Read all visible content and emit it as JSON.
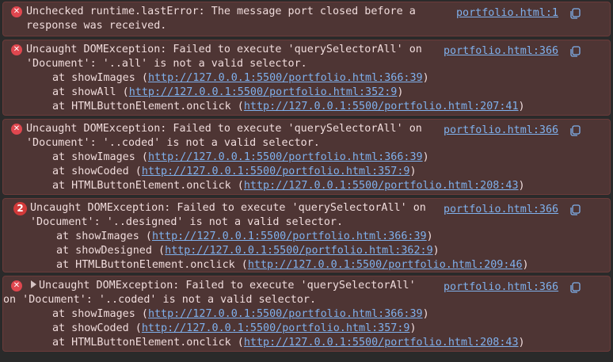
{
  "messages": [
    {
      "kind": "error",
      "lines": [
        "Unchecked runtime.lastError: The message port closed before a",
        "response was received."
      ],
      "source": "portfolio.html:1",
      "stack": []
    },
    {
      "kind": "error",
      "lines": [
        "Uncaught DOMException: Failed to execute 'querySelectorAll' on",
        "'Document': '..all' is not a valid selector."
      ],
      "source": "portfolio.html:366",
      "stack": [
        {
          "prefix": "at showImages (",
          "url": "http://127.0.0.1:5500/portfolio.html:366:39",
          "suffix": ")"
        },
        {
          "prefix": "at showAll (",
          "url": "http://127.0.0.1:5500/portfolio.html:352:9",
          "suffix": ")"
        },
        {
          "prefix": "at HTMLButtonElement.onclick (",
          "url": "http://127.0.0.1:5500/portfolio.html:207:41",
          "suffix": ")"
        }
      ]
    },
    {
      "kind": "error",
      "lines": [
        "Uncaught DOMException: Failed to execute 'querySelectorAll' on",
        "'Document': '..coded' is not a valid selector."
      ],
      "source": "portfolio.html:366",
      "stack": [
        {
          "prefix": "at showImages (",
          "url": "http://127.0.0.1:5500/portfolio.html:366:39",
          "suffix": ")"
        },
        {
          "prefix": "at showCoded (",
          "url": "http://127.0.0.1:5500/portfolio.html:357:9",
          "suffix": ")"
        },
        {
          "prefix": "at HTMLButtonElement.onclick (",
          "url": "http://127.0.0.1:5500/portfolio.html:208:43",
          "suffix": ")"
        }
      ]
    },
    {
      "kind": "error",
      "count": "2",
      "lines": [
        "Uncaught DOMException: Failed to execute 'querySelectorAll' on",
        "'Document': '..designed' is not a valid selector."
      ],
      "source": "portfolio.html:366",
      "stack": [
        {
          "prefix": "at showImages (",
          "url": "http://127.0.0.1:5500/portfolio.html:366:39",
          "suffix": ")"
        },
        {
          "prefix": "at showDesigned (",
          "url": "http://127.0.0.1:5500/portfolio.html:362:9",
          "suffix": ")"
        },
        {
          "prefix": "at HTMLButtonElement.onclick (",
          "url": "http://127.0.0.1:5500/portfolio.html:209:46",
          "suffix": ")"
        }
      ]
    },
    {
      "kind": "error",
      "expandable": true,
      "lines": [
        "Uncaught DOMException: Failed to execute 'querySelectorAll'",
        "on 'Document': '..coded' is not a valid selector."
      ],
      "source": "portfolio.html:366",
      "stack": [
        {
          "prefix": "at showImages (",
          "url": "http://127.0.0.1:5500/portfolio.html:366:39",
          "suffix": ")"
        },
        {
          "prefix": "at showCoded (",
          "url": "http://127.0.0.1:5500/portfolio.html:357:9",
          "suffix": ")"
        },
        {
          "prefix": "at HTMLButtonElement.onclick (",
          "url": "http://127.0.0.1:5500/portfolio.html:208:43",
          "suffix": ")"
        }
      ]
    }
  ],
  "icons": {
    "error": "error-circle-x-icon",
    "copy": "copy-icon",
    "expand": "expand-triangle-icon"
  },
  "colors": {
    "background": "#2a2a2a",
    "message_bg": "#4e3534",
    "link": "#7fb0ec",
    "error_icon": "#e0474f"
  }
}
